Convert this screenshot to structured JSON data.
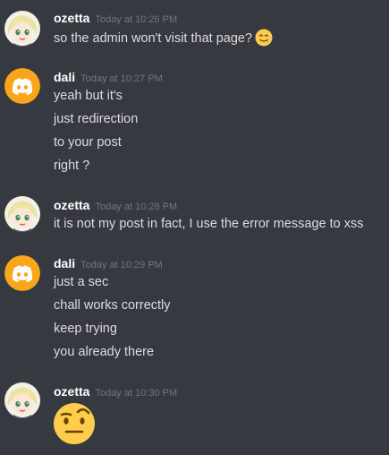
{
  "messages": [
    {
      "username": "ozetta",
      "timestamp": "Today at 10:26 PM",
      "avatar": "anime-girl-avatar",
      "lines": [
        "so the admin won't visit that page?"
      ],
      "inline_emoji": "tear-smile-emoji"
    },
    {
      "username": "dali",
      "timestamp": "Today at 10:27 PM",
      "avatar": "discord-logo-avatar",
      "lines": [
        "yeah but it's",
        "just redirection",
        "to your post",
        "right ?"
      ]
    },
    {
      "username": "ozetta",
      "timestamp": "Today at 10:28 PM",
      "avatar": "anime-girl-avatar",
      "lines": [
        "it is not my post in fact, I use the error message to xss"
      ]
    },
    {
      "username": "dali",
      "timestamp": "Today at 10:29 PM",
      "avatar": "discord-logo-avatar",
      "lines": [
        "just a sec",
        "chall works correctly",
        "keep trying",
        "you already there"
      ]
    },
    {
      "username": "ozetta",
      "timestamp": "Today at 10:30 PM",
      "avatar": "anime-girl-avatar",
      "big_emoji": "raised-eyebrow-emoji"
    }
  ],
  "colors": {
    "background": "#36393f",
    "username": "#ffffff",
    "timestamp": "#72767d",
    "text": "#dcddde",
    "discord_orange": "#faa61a"
  }
}
